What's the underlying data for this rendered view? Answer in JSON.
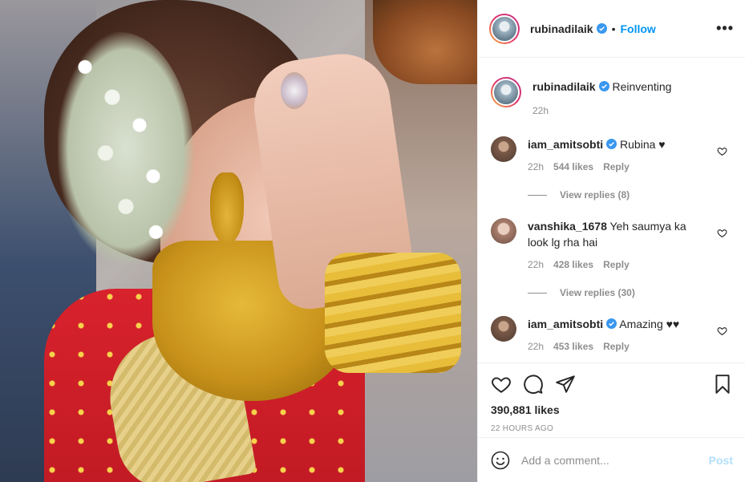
{
  "post": {
    "author": "rubinadilaik",
    "follow_label": "Follow",
    "dot": "•",
    "more_icon": "more-horizontal-icon",
    "caption": {
      "username": "rubinadilaik",
      "text": "Reinventing",
      "time": "22h"
    },
    "comments": [
      {
        "username": "iam_amitsobti",
        "text": "Rubina ♥",
        "time": "22h",
        "likes": "544 likes",
        "reply": "Reply",
        "view_replies": "View replies (8)"
      },
      {
        "username": "vanshika_1678",
        "text": "Yeh saumya ka look lg rha hai",
        "time": "22h",
        "likes": "428 likes",
        "reply": "Reply",
        "view_replies": "View replies (30)"
      },
      {
        "username": "iam_amitsobti",
        "text": "Amazing ♥♥",
        "time": "22h",
        "likes": "453 likes",
        "reply": "Reply"
      }
    ],
    "likes_total": "390,881 likes",
    "timestamp": "22 HOURS AGO",
    "add_comment_placeholder": "Add a comment...",
    "post_label": "Post"
  },
  "colors": {
    "accent": "#0095f6",
    "verified": "#3897f0",
    "muted": "#8e8e8e",
    "post_disabled": "#b2dffc"
  }
}
